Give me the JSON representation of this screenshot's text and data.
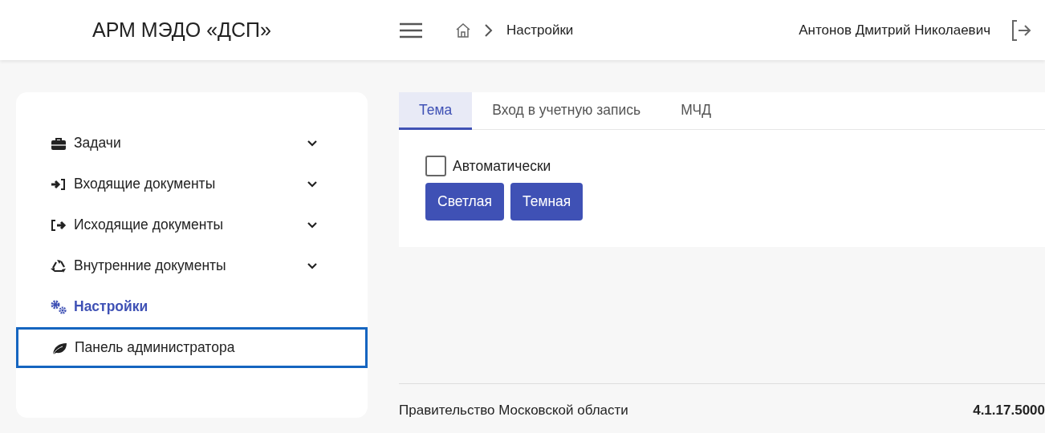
{
  "header": {
    "app_title": "АРМ МЭДО «ДСП»",
    "breadcrumb": [
      "Настройки"
    ],
    "user_name": "Антонов Дмитрий Николаевич"
  },
  "sidebar": {
    "items": [
      {
        "label": "Задачи",
        "kind": "briefcase",
        "expandable": true,
        "selected": false,
        "focused": false
      },
      {
        "label": "Входящие документы",
        "kind": "incoming",
        "expandable": true,
        "selected": false,
        "focused": false
      },
      {
        "label": "Исходящие документы",
        "kind": "outgoing",
        "expandable": true,
        "selected": false,
        "focused": false
      },
      {
        "label": "Внутренние документы",
        "kind": "internal",
        "expandable": true,
        "selected": false,
        "focused": false
      },
      {
        "label": "Настройки",
        "kind": "settings",
        "expandable": false,
        "selected": true,
        "focused": false
      },
      {
        "label": "Панель администратора",
        "kind": "admin",
        "expandable": false,
        "selected": false,
        "focused": true
      }
    ]
  },
  "tabs": [
    {
      "label": "Тема",
      "selected": true
    },
    {
      "label": "Вход в учетную запись",
      "selected": false
    },
    {
      "label": "МЧД",
      "selected": false
    }
  ],
  "theme_panel": {
    "auto_checkbox": {
      "label": "Автоматически",
      "checked": false
    },
    "buttons": [
      "Светлая",
      "Темная"
    ]
  },
  "footer": {
    "organization": "Правительство Московской области",
    "version": "4.1.17.5000"
  }
}
